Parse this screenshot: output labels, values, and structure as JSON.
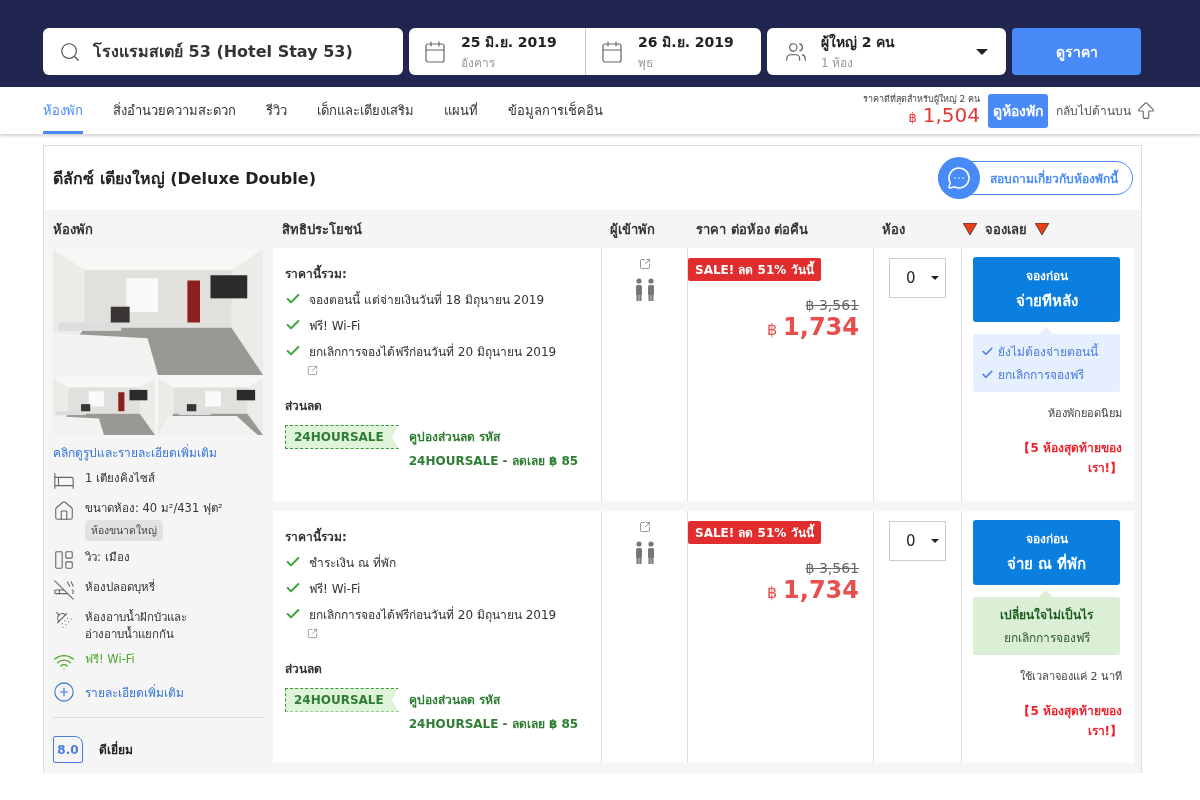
{
  "header": {
    "search": {
      "value": "โรงแรมสเตย์ 53 (Hotel Stay 53)"
    },
    "check_in": {
      "date": "25 มิ.ย. 2019",
      "day": "อังคาร"
    },
    "check_out": {
      "date": "26 มิ.ย. 2019",
      "day": "พุธ"
    },
    "guests": {
      "main": "ผู้ใหญ่ 2 คน",
      "sub": "1 ห้อง"
    },
    "search_button": "ดูราคา"
  },
  "nav": {
    "tabs": [
      {
        "label": "ห้องพัก",
        "selected": true
      },
      {
        "label": "สิ่งอำนวยความสะดวก",
        "selected": false
      },
      {
        "label": "รีวิว",
        "selected": false
      },
      {
        "label": "เด็กและเตียงเสริม",
        "selected": false
      },
      {
        "label": "แผนที่",
        "selected": false
      },
      {
        "label": "ข้อมูลการเช็คอิน",
        "selected": false
      }
    ],
    "best_price": {
      "caption": "ราคาดีที่สุดสำหรับผู้ใหญ่ 2 คน",
      "currency": "฿",
      "amount": "1,504"
    },
    "view_rooms_button": "ดูห้องพัก",
    "back_to_top": "กลับไปด้านบน"
  },
  "room": {
    "title": "ดีลักซ์ เตียงใหญ่ (Deluxe Double)",
    "ask_button": "สอบถามเกี่ยวกับห้องพักนี้",
    "columns": [
      {
        "label": "ห้องพัก",
        "flagged": false
      },
      {
        "label": "สิทธิประโยชน์",
        "flagged": false
      },
      {
        "label": "ผู้เข้าพัก",
        "flagged": false
      },
      {
        "label": "ราคา ต่อห้อง ต่อคืน",
        "flagged": false
      },
      {
        "label": "ห้อง",
        "flagged": false
      },
      {
        "label": "จองเลย",
        "flagged": true
      }
    ],
    "photo_link": "คลิกดูรูปและรายละเอียดเพิ่มเติม",
    "features": [
      {
        "kind": "bed",
        "text": "1 เตียงคิงไซส์"
      },
      {
        "kind": "size",
        "text": "ขนาดห้อง: 40 ม²/431 ฟุต²",
        "tag": "ห้องขนาดใหญ่"
      },
      {
        "kind": "view",
        "text": "วิว: เมือง"
      },
      {
        "kind": "no-smoking",
        "text": "ห้องปลอดบุหรี่"
      },
      {
        "kind": "bath",
        "text": "ห้องอาบน้ำฝักบัวและ อ่างอาบน้ำแยกกัน"
      },
      {
        "kind": "wifi",
        "text": "ฟรี! Wi-Fi"
      }
    ],
    "more_details": "รายละเอียดเพิ่มเติม",
    "rating": {
      "score": "8.0",
      "label": "ดีเยี่ยม"
    }
  },
  "offers": [
    {
      "includes_label": "ราคานี้รวม:",
      "benefits": [
        "จองตอนนี้ แต่จ่ายเงินวันที่ 18 มิถุนายน 2019",
        "ฟรี! Wi-Fi",
        "ยกเลิกการจองได้ฟรีก่อนวันที่ 20 มิถุนายน 2019"
      ],
      "discount_label": "ส่วนลด",
      "coupon": {
        "code": "24HOURSALE",
        "text": "คูปองส่วนลด รหัส 24HOURSALE - ลดเลย ฿ 85"
      },
      "sale_badge": "SALE! ลด 51% วันนี้",
      "old_price": "฿ 3,561",
      "currency": "฿",
      "price": "1,734",
      "quantity": "0",
      "book_button": [
        "จองก่อน",
        "จ่ายทีหลัง"
      ],
      "perks": {
        "kind": "checklist",
        "lines": [
          "ยังไม่ต้องจ่ายตอนนี้",
          "ยกเลิกการจองฟรี"
        ]
      },
      "note": "ห้องพักยอดนิยม",
      "scarcity": "【5 ห้องสุดท้ายของเรา!】"
    },
    {
      "includes_label": "ราคานี้รวม:",
      "benefits": [
        "ชำระเงิน ณ ที่พัก",
        "ฟรี! Wi-Fi",
        "ยกเลิกการจองได้ฟรีก่อนวันที่ 20 มิถุนายน 2019"
      ],
      "discount_label": "ส่วนลด",
      "coupon": {
        "code": "24HOURSALE",
        "text": "คูปองส่วนลด รหัส 24HOURSALE - ลดเลย ฿ 85"
      },
      "sale_badge": "SALE! ลด 51% วันนี้",
      "old_price": "฿ 3,561",
      "currency": "฿",
      "price": "1,734",
      "quantity": "0",
      "book_button": [
        "จองก่อน",
        "จ่าย ณ ที่พัก"
      ],
      "perks": {
        "kind": "message",
        "lines": [
          "เปลี่ยนใจไม่เป็นไร",
          "ยกเลิกการจองฟรี"
        ]
      },
      "note": "ใช้เวลาจองแค่ 2 นาที",
      "scarcity": "【5 ห้องสุดท้ายของเรา!】"
    }
  ]
}
